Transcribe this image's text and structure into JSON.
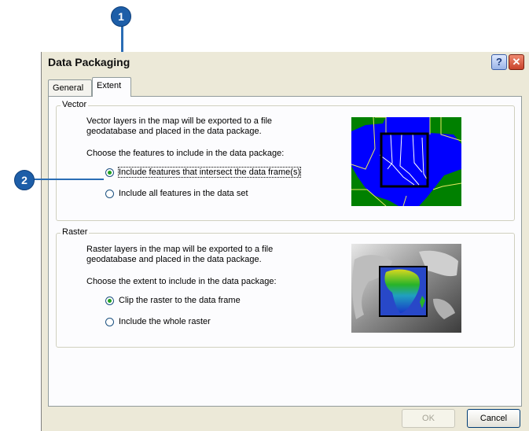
{
  "dialog": {
    "title": "Data Packaging",
    "help_label": "?",
    "close_label": "✕"
  },
  "callouts": [
    "1",
    "2"
  ],
  "tabs": [
    {
      "label": "General",
      "selected": false
    },
    {
      "label": "Extent",
      "selected": true
    }
  ],
  "vector": {
    "legend": "Vector",
    "description": "Vector layers in the map will be exported to a file geodatabase and placed in the data package.",
    "prompt": "Choose the features to include in the data package:",
    "options": [
      {
        "label": "Include features that intersect the data frame(s)",
        "checked": true
      },
      {
        "label": "Include all features in the data set",
        "checked": false
      }
    ]
  },
  "raster": {
    "legend": "Raster",
    "description": "Raster layers in the map will be exported to a file geodatabase and placed in the data package.",
    "prompt": "Choose the extent to include in the data package:",
    "options": [
      {
        "label": "Clip the raster to the data frame",
        "checked": true
      },
      {
        "label": "Include the whole raster",
        "checked": false
      }
    ]
  },
  "buttons": {
    "ok": "OK",
    "cancel": "Cancel"
  },
  "colors": {
    "callout": "#1d5ea8",
    "dialog_bg": "#ece9d8",
    "vector_fill": "#0000ff",
    "vector_bg": "#008000",
    "radio_dot": "#21a121"
  }
}
